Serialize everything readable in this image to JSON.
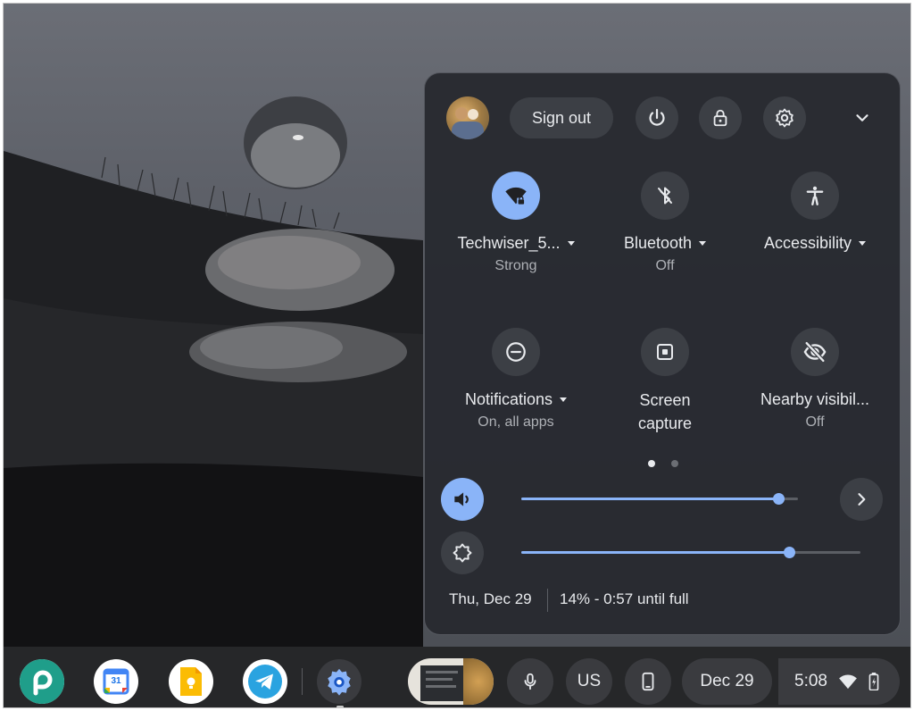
{
  "quick_settings": {
    "sign_out_label": "Sign out",
    "header_icons": [
      "power-icon",
      "lock-icon",
      "gear-icon",
      "chevron-down-icon"
    ],
    "tiles_row1": [
      {
        "label": "Techwiser_5...",
        "sub": "Strong",
        "icon": "wifi-lock-icon",
        "active": true
      },
      {
        "label": "Bluetooth",
        "sub": "Off",
        "icon": "bluetooth-off-icon",
        "active": false
      },
      {
        "label": "Accessibility",
        "sub": "",
        "icon": "accessibility-icon",
        "active": false
      }
    ],
    "tiles_row2": [
      {
        "label": "Notifications",
        "sub": "On, all apps",
        "icon": "notifications-icon",
        "active": false
      },
      {
        "label_line1": "Screen",
        "label_line2": "capture",
        "icon": "screen-capture-icon",
        "active": false
      },
      {
        "label": "Nearby visibil...",
        "sub": "Off",
        "icon": "nearby-visibility-off-icon",
        "active": false
      }
    ],
    "page_indicator": {
      "pages": 2,
      "current": 1
    },
    "volume_level": 0.93,
    "brightness_level": 0.79,
    "date": "Thu, Dec 29",
    "battery": "14% - 0:57 until full",
    "accent_color": "#8ab4f8"
  },
  "shelf": {
    "apps": [
      {
        "name": "picsart-app-icon"
      },
      {
        "name": "google-calendar-app-icon",
        "badge": "31"
      },
      {
        "name": "google-keep-app-icon"
      },
      {
        "name": "telegram-app-icon"
      },
      {
        "name": "settings-app-icon"
      }
    ],
    "input_method": "US",
    "date": "Dec 29",
    "time": "5:08"
  }
}
